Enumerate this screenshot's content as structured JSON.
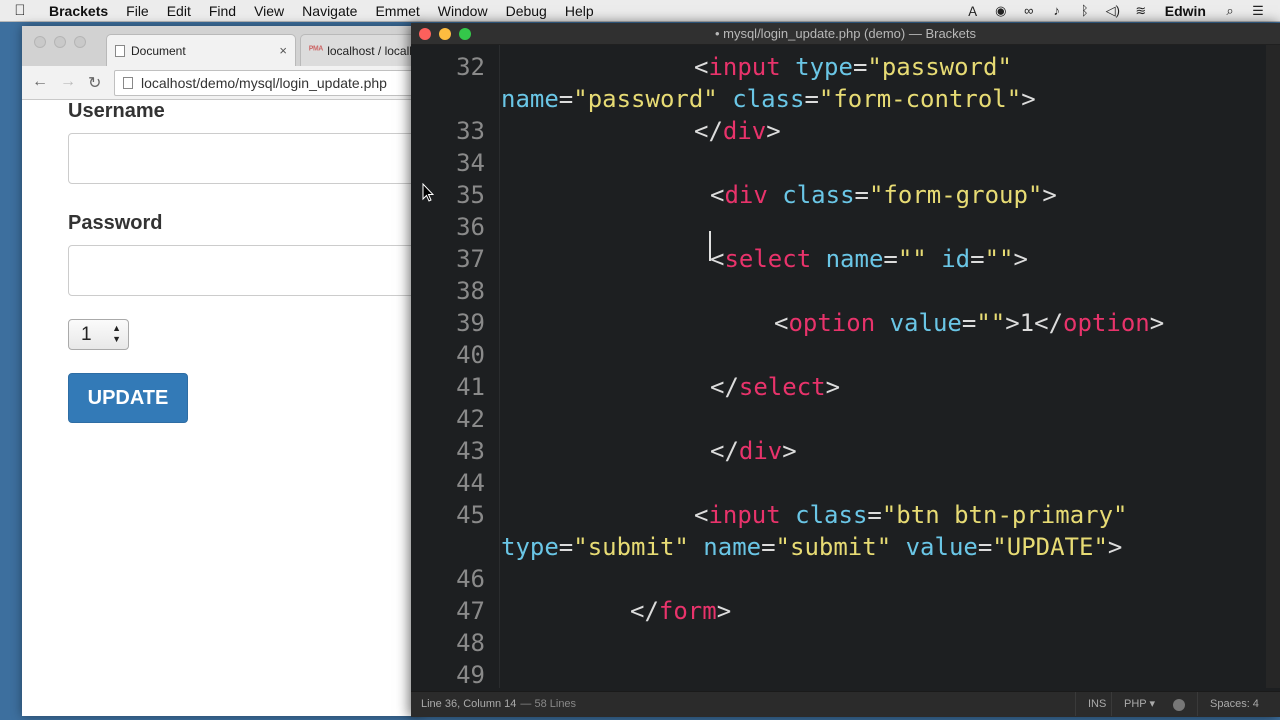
{
  "menubar": {
    "apple": "",
    "app_name": "Brackets",
    "items": [
      "File",
      "Edit",
      "Find",
      "View",
      "Navigate",
      "Emmet",
      "Window",
      "Debug",
      "Help"
    ],
    "user": "Edwin"
  },
  "browser": {
    "tabs": [
      {
        "title": "Document",
        "close": "×"
      },
      {
        "title": "localhost / localh"
      }
    ],
    "url": "localhost/demo/mysql/login_update.php",
    "page": {
      "username_label": "Username",
      "password_label": "Password",
      "select_value": "1",
      "update_button": "UPDATE"
    }
  },
  "editor": {
    "title": "• mysql/login_update.php (demo) — Brackets",
    "lines": [
      {
        "num": "32",
        "segments": [
          [
            "p",
            "<"
          ],
          [
            "t",
            "input"
          ],
          [
            "p",
            " "
          ],
          [
            "a",
            "type"
          ],
          [
            "p",
            "="
          ],
          [
            "s",
            "\"password\""
          ]
        ]
      },
      {
        "num": "",
        "segments": [
          [
            "a",
            "name"
          ],
          [
            "p",
            "="
          ],
          [
            "s",
            "\"password\""
          ],
          [
            "p",
            " "
          ],
          [
            "a",
            "class"
          ],
          [
            "p",
            "="
          ],
          [
            "s",
            "\"form-control\""
          ],
          [
            "p",
            ">"
          ]
        ]
      },
      {
        "num": "33",
        "segments": [
          [
            "p",
            "</"
          ],
          [
            "t",
            "div"
          ],
          [
            "p",
            ">"
          ]
        ]
      },
      {
        "num": "34",
        "segments": []
      },
      {
        "num": "35",
        "segments": [
          [
            "p",
            "<"
          ],
          [
            "t",
            "div"
          ],
          [
            "p",
            " "
          ],
          [
            "a",
            "class"
          ],
          [
            "p",
            "="
          ],
          [
            "s",
            "\"form-group\""
          ],
          [
            "p",
            ">"
          ]
        ]
      },
      {
        "num": "36",
        "segments": []
      },
      {
        "num": "37",
        "segments": [
          [
            "p",
            "<"
          ],
          [
            "t",
            "select"
          ],
          [
            "p",
            " "
          ],
          [
            "a",
            "name"
          ],
          [
            "p",
            "="
          ],
          [
            "s",
            "\"\""
          ],
          [
            "p",
            " "
          ],
          [
            "a",
            "id"
          ],
          [
            "p",
            "="
          ],
          [
            "s",
            "\"\""
          ],
          [
            "p",
            ">"
          ]
        ]
      },
      {
        "num": "38",
        "segments": []
      },
      {
        "num": "39",
        "segments": [
          [
            "p",
            "<"
          ],
          [
            "t",
            "option"
          ],
          [
            "p",
            " "
          ],
          [
            "a",
            "value"
          ],
          [
            "p",
            "="
          ],
          [
            "s",
            "\"\""
          ],
          [
            "p",
            ">1</"
          ],
          [
            "t",
            "option"
          ],
          [
            "p",
            ">"
          ]
        ]
      },
      {
        "num": "40",
        "segments": []
      },
      {
        "num": "41",
        "segments": [
          [
            "p",
            "</"
          ],
          [
            "t",
            "select"
          ],
          [
            "p",
            ">"
          ]
        ]
      },
      {
        "num": "42",
        "segments": []
      },
      {
        "num": "43",
        "segments": [
          [
            "p",
            "</"
          ],
          [
            "t",
            "div"
          ],
          [
            "p",
            ">"
          ]
        ]
      },
      {
        "num": "44",
        "segments": []
      },
      {
        "num": "45",
        "segments": [
          [
            "p",
            "<"
          ],
          [
            "t",
            "input"
          ],
          [
            "p",
            " "
          ],
          [
            "a",
            "class"
          ],
          [
            "p",
            "="
          ],
          [
            "s",
            "\"btn btn-primary\""
          ]
        ]
      },
      {
        "num": "",
        "segments": [
          [
            "a",
            "type"
          ],
          [
            "p",
            "="
          ],
          [
            "s",
            "\"submit\""
          ],
          [
            "p",
            " "
          ],
          [
            "a",
            "name"
          ],
          [
            "p",
            "="
          ],
          [
            "s",
            "\"submit\""
          ],
          [
            "p",
            " "
          ],
          [
            "a",
            "value"
          ],
          [
            "p",
            "="
          ],
          [
            "s",
            "\"UPDATE\""
          ],
          [
            "p",
            ">"
          ]
        ]
      },
      {
        "num": "46",
        "segments": []
      },
      {
        "num": "47",
        "segments": [
          [
            "p",
            "</"
          ],
          [
            "t",
            "form"
          ],
          [
            "p",
            ">"
          ]
        ]
      },
      {
        "num": "48",
        "segments": []
      },
      {
        "num": "49",
        "segments": []
      }
    ],
    "status": {
      "position": "Line 36, Column 14",
      "lines": "— 58 Lines",
      "mode": "INS",
      "language": "PHP ▾",
      "spaces": "Spaces: 4"
    }
  },
  "colors": {
    "tag": "#e8336b",
    "attribute": "#6ac6e6",
    "string": "#e7db74",
    "button_primary": "#337ab7"
  }
}
